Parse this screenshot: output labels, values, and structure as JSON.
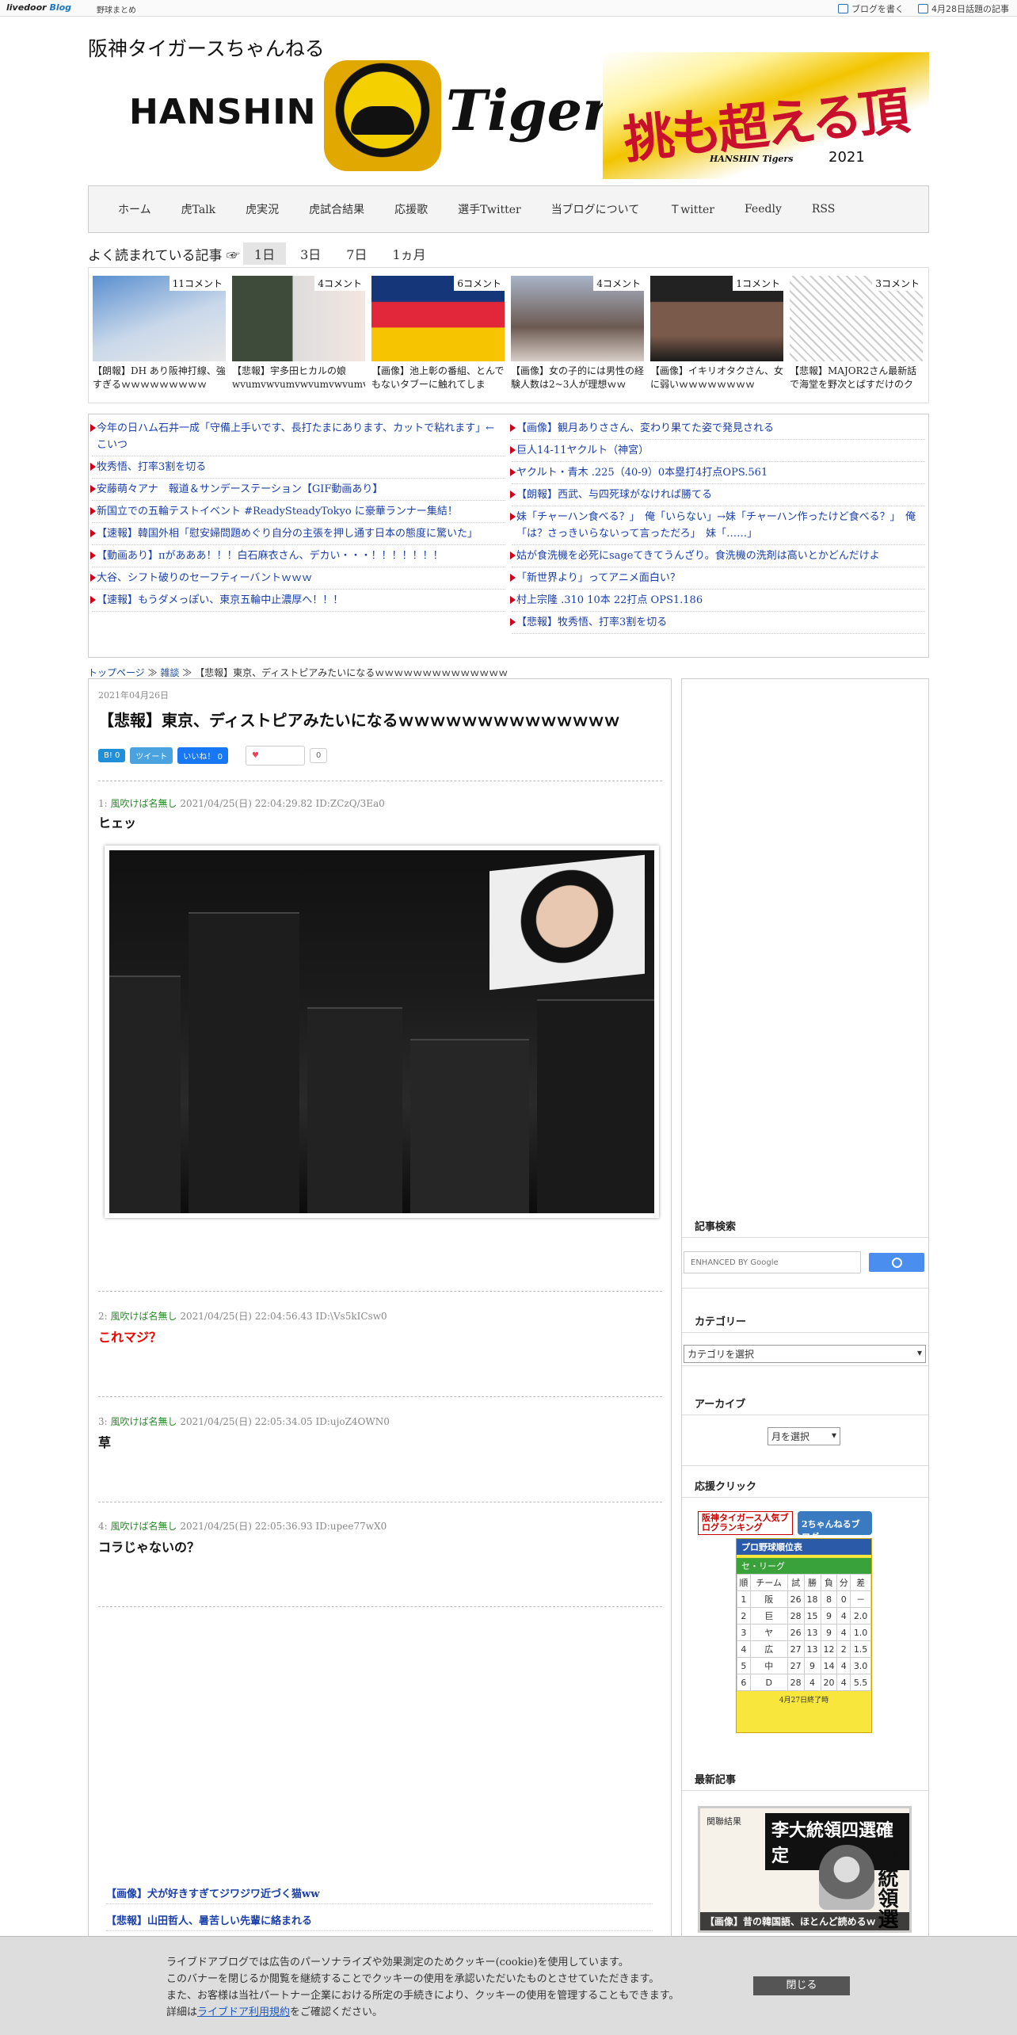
{
  "topbar": {
    "logo_a": "livedoor",
    "logo_b": "Blog",
    "category": "野球まとめ",
    "write": "ブログを書く",
    "trend": "4月28日話題の記事"
  },
  "site": {
    "title": "阪神タイガースちゃんねる",
    "banner_left": "HANSHIN",
    "banner_right": "Tigers",
    "slogan": "挑も超える頂へ",
    "slogan_sub": "HANSHIN Tigers",
    "slogan_year": "2021"
  },
  "nav": [
    "ホーム",
    "虎Talk",
    "虎実況",
    "虎試合結果",
    "応援歌",
    "選手Twitter",
    "当ブログについて",
    "Ｔwitter",
    "Feedly",
    "RSS"
  ],
  "popular": {
    "label": "よく読まれている記事 ☞",
    "tabs": [
      "1日",
      "3日",
      "7日",
      "1ヵ月"
    ],
    "items": [
      {
        "count": "11コメント",
        "title": "【朗報】DH あり阪神打線、強すぎるｗｗｗｗｗｗｗｗｗ"
      },
      {
        "count": "4コメント",
        "title": "【悲報】宇多田ヒカルの娘 wvumvwvumvwvumvwvumvwvum"
      },
      {
        "count": "6コメント",
        "title": "【画像】池上彰の番組、とんでもないタブーに触れてしま"
      },
      {
        "count": "4コメント",
        "title": "【画像】女の子的には男性の経験人数は2~3人が理想ｗｗ"
      },
      {
        "count": "1コメント",
        "title": "【画像】イキリオタクさん、女に弱いｗｗｗｗｗｗｗｗ"
      },
      {
        "count": "3コメント",
        "title": "【悲報】MAJOR2さん最新話で海堂を野次とばすだけのク"
      }
    ]
  },
  "links": {
    "left": [
      "今年の日ハム石井一成「守備上手いです、長打たまにあります、カットで粘れます」←こいつ",
      "牧秀悟、打率3割を切る",
      "安藤萌々アナ　報道＆サンデーステーション【GIF動画あり】",
      "新国立での五輪テストイベント #ReadySteadyTokyo に豪華ランナー集結！",
      "【速報】韓国外相「慰安婦問題めぐり自分の主張を押し通す日本の態度に驚いた」",
      "【動画あり】πがあああ！！！白石麻衣さん、デカい・・・！！！！！！！",
      "大谷、シフト破りのセーフティーバントｗｗｗ",
      "【速報】もうダメっぽい、東京五輪中止濃厚へ！！！"
    ],
    "right": [
      "【画像】観月ありささん、変わり果てた姿で発見される",
      "巨人14-11ヤクルト（神宮）",
      "ヤクルト・青木 .225（40-9）0本塁打4打点OPS.561",
      "【朗報】西武、与四死球がなければ勝てる",
      "妹「チャーハン食べる？」　俺「いらない」→妹「チャーハン作ったけど食べる？」　俺「は？さっきいらないって言っただろ」　妹「……」",
      "姑が食洗機を必死にsageてきてうんざり。食洗機の洗剤は高いとかどんだけよ",
      "「新世界より」ってアニメ面白い？",
      "村上宗隆 .310 10本 22打点 OPS1.186",
      "【悲報】牧秀悟、打率3割を切る"
    ]
  },
  "breadcrumb": {
    "top": "トップページ",
    "sep": "≫",
    "cat": "雑談",
    "current": "【悲報】東京、ディストピアみたいになるｗｗｗｗｗｗｗｗｗｗｗｗｗｗ"
  },
  "post": {
    "date": "2021年04月26日",
    "title": "【悲報】東京、ディストピアみたいになるｗｗｗｗｗｗｗｗｗｗｗｗｗｗ",
    "share": {
      "hatena": "B! 0",
      "tweet": "ツイート",
      "like": "いいね！ 0",
      "pocket": "Pocket",
      "pocket_count": "0"
    },
    "res": [
      {
        "no": "1:",
        "name": "風吹けば名無し",
        "meta": "2021/04/25(日) 22:04:29.82 ID:ZCzQ/3Ea0",
        "body": "ヒェッ"
      },
      {
        "no": "2:",
        "name": "風吹けば名無し",
        "meta": "2021/04/25(日) 22:04:56.43 ID:\\Vs5kICsw0",
        "body": "これマジ？"
      },
      {
        "no": "3:",
        "name": "風吹けば名無し",
        "meta": "2021/04/25(日) 22:05:34.05 ID:ujoZ4OWN0",
        "body": "草"
      },
      {
        "no": "4:",
        "name": "風吹けば名無し",
        "meta": "2021/04/25(日) 22:05:36.93 ID:upee77wX0",
        "body": "コラじゃないの？"
      }
    ],
    "related": [
      "【画像】犬が好きすぎてジワジワ近づく猫ww",
      "【悲報】山田哲人、暑苦しい先輩に絡まれる"
    ]
  },
  "sidebar": {
    "search_h": "記事検索",
    "search_ph": "ENHANCED BY Google",
    "category_h": "カテゴリー",
    "category_sel": "カテゴリを選択",
    "archive_h": "アーカイブ",
    "archive_sel": "月を選択",
    "support_h": "応援クリック",
    "rank_b1": "阪神タイガース人気ブログランキング",
    "rank_b2": "2ちゃんねるブログ",
    "rank_title": "プロ野球順位表",
    "rank_league": "セ・リーグ",
    "rank_cols": [
      "順",
      "チーム",
      "試",
      "勝",
      "負",
      "分",
      "差"
    ],
    "rank_rows": [
      [
        "1",
        "阪",
        "26",
        "18",
        "8",
        "0",
        "－"
      ],
      [
        "2",
        "巨",
        "28",
        "15",
        "9",
        "4",
        "2.0"
      ],
      [
        "3",
        "ヤ",
        "26",
        "13",
        "9",
        "4",
        "1.0"
      ],
      [
        "4",
        "広",
        "27",
        "13",
        "12",
        "2",
        "1.5"
      ],
      [
        "5",
        "中",
        "27",
        "9",
        "14",
        "4",
        "3.0"
      ],
      [
        "6",
        "D",
        "28",
        "4",
        "20",
        "4",
        "5.5"
      ]
    ],
    "rank_foot": "4月27日終了時",
    "latest_h": "最新記事",
    "latest_head": "李大統領四選確定",
    "latest_vert": "副統領選",
    "latest_np": "関聯結果",
    "latest_cap": "【画像】昔の韓国語、ほとんど読めるｗ"
  },
  "cookie": {
    "l1": "ライブドアブログでは広告のパーソナライズや効果測定のためクッキー(cookie)を使用しています。",
    "l2": "このバナーを閉じるか閲覧を継続することでクッキーの使用を承認いただいたものとさせていただきます。",
    "l3": "また、お客様は当社パートナー企業における所定の手続きにより、クッキーの使用を管理することもできます。",
    "l4a": "詳細は",
    "l4b": "ライブドア利用規約",
    "l4c": "をご確認ください。",
    "close": "閉じる"
  }
}
